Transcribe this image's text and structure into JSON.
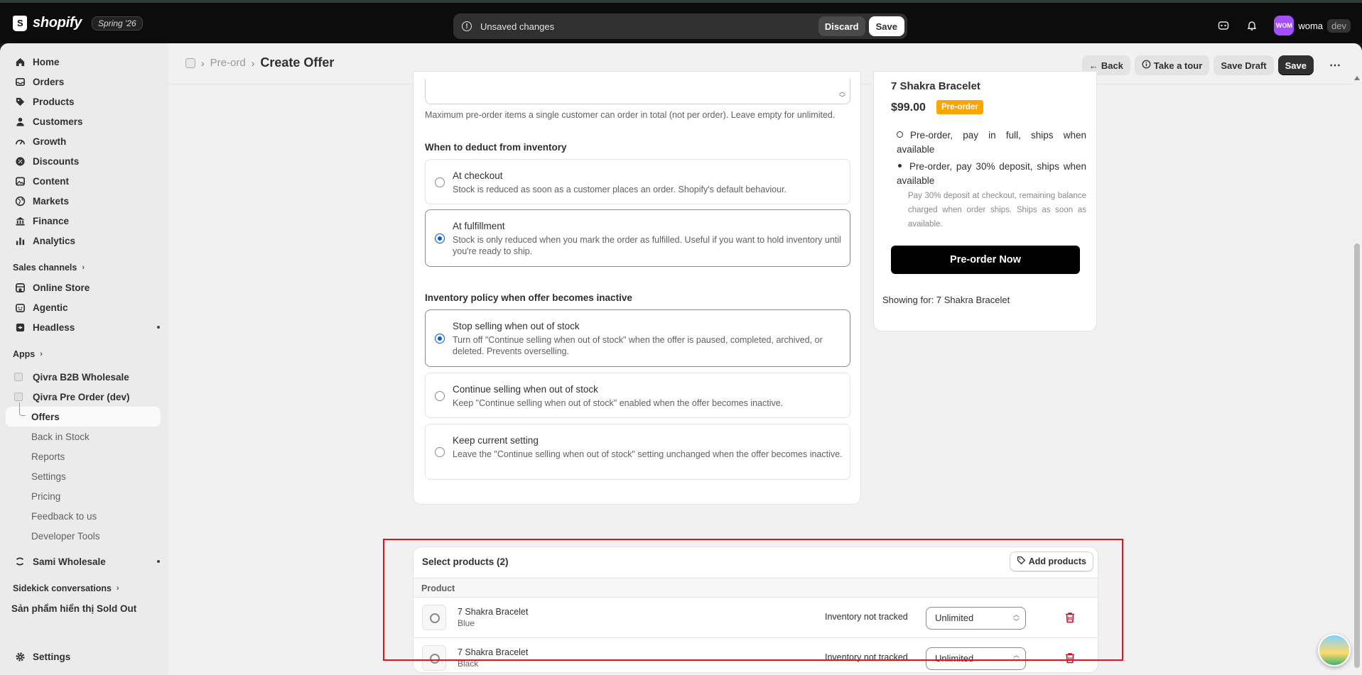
{
  "topbar": {
    "brand": "shopify",
    "edition": "Spring '26",
    "unsaved_message": "Unsaved changes",
    "discard_label": "Discard",
    "save_label": "Save",
    "avatar_initials": "WOM",
    "account_name": "woma",
    "account_env": "dev"
  },
  "sidebar": {
    "main_items": [
      {
        "label": "Home",
        "icon": "home-icon"
      },
      {
        "label": "Orders",
        "icon": "inbox-icon"
      },
      {
        "label": "Products",
        "icon": "tag-icon"
      },
      {
        "label": "Customers",
        "icon": "person-icon"
      },
      {
        "label": "Growth",
        "icon": "gauge-icon"
      },
      {
        "label": "Discounts",
        "icon": "discount-icon"
      },
      {
        "label": "Content",
        "icon": "image-icon"
      },
      {
        "label": "Markets",
        "icon": "globe-icon"
      },
      {
        "label": "Finance",
        "icon": "bank-icon"
      },
      {
        "label": "Analytics",
        "icon": "bar-chart-icon"
      }
    ],
    "sales_channels_label": "Sales channels",
    "channels": [
      {
        "label": "Online Store",
        "icon": "store-icon"
      },
      {
        "label": "Agentic",
        "icon": "robot-icon"
      },
      {
        "label": "Headless",
        "icon": "layers-icon"
      }
    ],
    "apps_label": "Apps",
    "apps": [
      {
        "label": "Qivra B2B Wholesale"
      },
      {
        "label": "Qivra Pre Order (dev)"
      }
    ],
    "active_sub": "Offers",
    "sub_items": [
      "Back in Stock",
      "Reports",
      "Settings",
      "Pricing",
      "Feedback to us",
      "Developer Tools"
    ],
    "other_app": "Sami Wholesale",
    "sidekick_label": "Sidekick conversations",
    "sidekick_item": "Sản phẩm hiển thị Sold Out",
    "settings_label": "Settings"
  },
  "header": {
    "breadcrumb_prev": "Pre-ord",
    "title": "Create Offer",
    "back_label": "Back",
    "tour_label": "Take a tour",
    "draft_label": "Save Draft",
    "save_label": "Save"
  },
  "form": {
    "limit_help": "Maximum pre-order items a single customer can order in total (not per order). Leave empty for unlimited.",
    "deduct_title": "When to deduct from inventory",
    "deduct_options": [
      {
        "label": "At checkout",
        "desc": "Stock is reduced as soon as a customer places an order. Shopify's default behaviour.",
        "selected": false
      },
      {
        "label": "At fulfillment",
        "desc": "Stock is only reduced when you mark the order as fulfilled. Useful if you want to hold inventory until you're ready to ship.",
        "selected": true
      }
    ],
    "policy_title": "Inventory policy when offer becomes inactive",
    "policy_options": [
      {
        "label": "Stop selling when out of stock",
        "desc": "Turn off \"Continue selling when out of stock\" when the offer is paused, completed, archived, or deleted. Prevents overselling.",
        "selected": true
      },
      {
        "label": "Continue selling when out of stock",
        "desc": "Keep \"Continue selling when out of stock\" enabled when the offer becomes inactive.",
        "selected": false
      },
      {
        "label": "Keep current setting",
        "desc": "Leave the \"Continue selling when out of stock\" setting unchanged when the offer becomes inactive.",
        "selected": false
      }
    ]
  },
  "preview": {
    "product_title": "7 Shakra Bracelet",
    "price": "$99.00",
    "badge": "Pre-order",
    "plan_full": "Pre-order, pay in full, ships when available",
    "plan_deposit": "Pre-order, pay 30% deposit, ships when available",
    "plan_deposit_detail": "Pay 30% deposit at checkout, remaining balance charged when order ships. Ships as soon as available.",
    "button": "Pre-order Now",
    "showing_for": "Showing for: 7 Shakra Bracelet"
  },
  "products": {
    "title": "Select products (2)",
    "add_label": "Add products",
    "column_product": "Product",
    "rows": [
      {
        "name": "7 Shakra Bracelet",
        "variant": "Blue",
        "inventory": "Inventory not tracked",
        "limit": "Unlimited"
      },
      {
        "name": "7 Shakra Bracelet",
        "variant": "Black",
        "inventory": "Inventory not tracked",
        "limit": "Unlimited"
      }
    ]
  },
  "colors": {
    "accent": "#005bd3",
    "highlight": "#e0141e",
    "badge": "#ffa500",
    "danger": "#c70a24"
  }
}
